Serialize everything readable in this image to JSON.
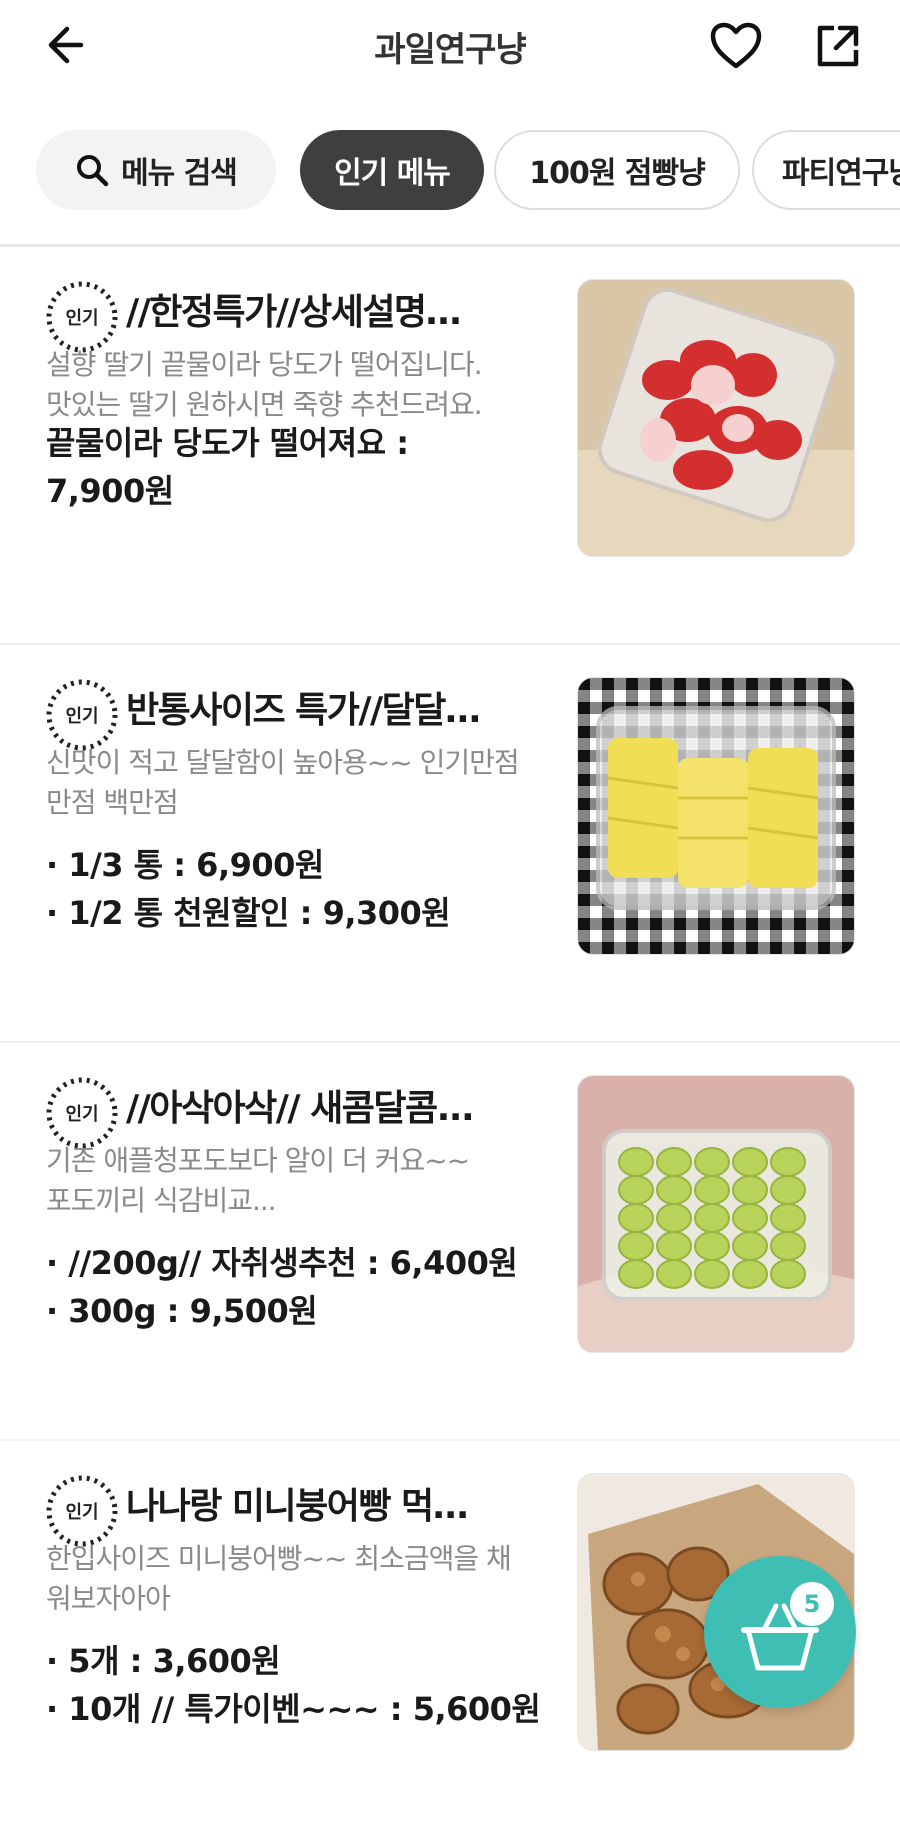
{
  "header": {
    "title": "과일연구냥",
    "icons": [
      "back-arrow-icon",
      "heart-icon",
      "share-icon"
    ]
  },
  "chips": [
    {
      "label": "메뉴 검색",
      "icon": "search-icon"
    },
    {
      "label": "인기 메뉴",
      "selected": true
    },
    {
      "label": "100원 점빵냥"
    },
    {
      "label": "파티연구냥"
    }
  ],
  "menu": [
    {
      "badge": "인기",
      "name": "//한정특가//상세설명…",
      "description": [
        "설향 딸기 끝물이라 당도가 떨어집니다.",
        "맛있는 딸기 원하시면 죽향 추천드려요."
      ],
      "prices": [
        "끝물이라 당도가 떨어져요 :",
        "7,900원"
      ],
      "image": "strawberry-container"
    },
    {
      "badge": "인기",
      "name": "반통사이즈 특가//달달…",
      "description": [
        "신맛이 적고 달달함이 높아용~~ 인기만점",
        "만점 백만점"
      ],
      "prices": [
        "· 1/3 통 : 6,900원",
        "· 1/2 통 천원할인 : 9,300원"
      ],
      "image": "pineapple-container"
    },
    {
      "badge": "인기",
      "name": "//아삭아삭// 새콤달콤...",
      "description": [
        "기존 애플청포도보다 알이 더 커요~~",
        "포도끼리 식감비교..."
      ],
      "prices": [
        "· //200g// 자취생추천 : 6,400원",
        "· 300g : 9,500원"
      ],
      "image": "green-grape-container"
    },
    {
      "badge": "인기",
      "name": "나나랑 미니붕어빵 먹…",
      "description": [
        "한입사이즈 미니붕어빵~~ 최소금액을 채",
        "워보자아아"
      ],
      "prices": [
        "· 5개 : 3,600원",
        "· 10개 // 특가이벤~~~ : 5,600원"
      ],
      "image": "mini-fish-bread-bag"
    }
  ],
  "cart": {
    "count": "5",
    "icon": "shopping-basket-icon",
    "color": "#3fbfb4"
  },
  "colors": {
    "accent": "#3fbfb4",
    "selected_chip": "#3f3f3f",
    "description_text": "#8a8a8a"
  }
}
